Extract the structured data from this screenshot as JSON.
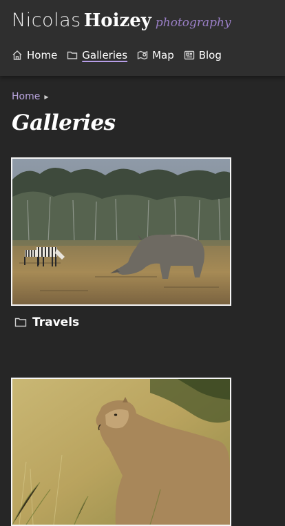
{
  "site": {
    "title_first": "Nicolas",
    "title_last": "Hoizey",
    "title_sub": "photography"
  },
  "nav": {
    "items": [
      {
        "label": "Home",
        "icon": "home-icon"
      },
      {
        "label": "Galleries",
        "icon": "folder-icon",
        "active": true
      },
      {
        "label": "Map",
        "icon": "map-icon"
      },
      {
        "label": "Blog",
        "icon": "news-icon"
      }
    ]
  },
  "breadcrumb": {
    "home": "Home"
  },
  "page": {
    "title": "Galleries"
  },
  "galleries": [
    {
      "title": "Travels",
      "icon": "folder-icon"
    },
    {
      "title": "",
      "icon": "folder-icon"
    }
  ],
  "colors": {
    "background": "#262626",
    "header": "#2f2f2f",
    "accent": "#9a7fc6"
  }
}
